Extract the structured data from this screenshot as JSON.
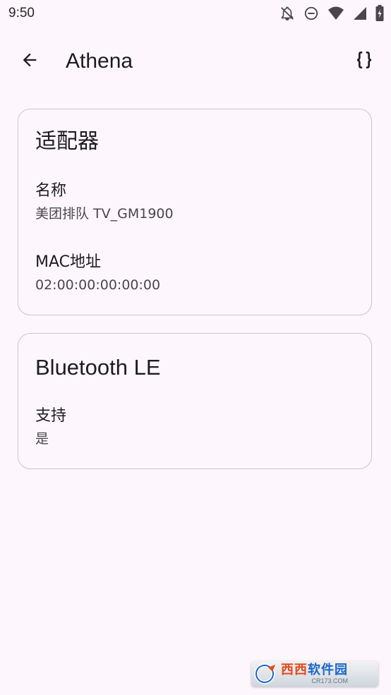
{
  "status_bar": {
    "time": "9:50",
    "icons": [
      "notifications-off-icon",
      "do-not-disturb-icon",
      "wifi-icon",
      "signal-icon",
      "battery-charging-icon"
    ]
  },
  "app_bar": {
    "title": "Athena",
    "back_icon": "arrow-back-icon",
    "action_icon": "code-braces-icon"
  },
  "cards": {
    "adapter": {
      "title": "适配器",
      "fields": [
        {
          "label": "名称",
          "value": "美团排队 TV_GM1900"
        },
        {
          "label": "MAC地址",
          "value": "02:00:00:00:00:00"
        }
      ]
    },
    "ble": {
      "title": "Bluetooth LE",
      "fields": [
        {
          "label": "支持",
          "value": "是"
        }
      ]
    }
  },
  "watermark": {
    "main_part1": "西西",
    "main_part2": "软件园",
    "sub": "CR173.COM"
  },
  "colors": {
    "background": "#fdf7fd",
    "card_border": "#cac4cf",
    "primary_text": "#1d1b20",
    "secondary_text": "#4a454e"
  }
}
